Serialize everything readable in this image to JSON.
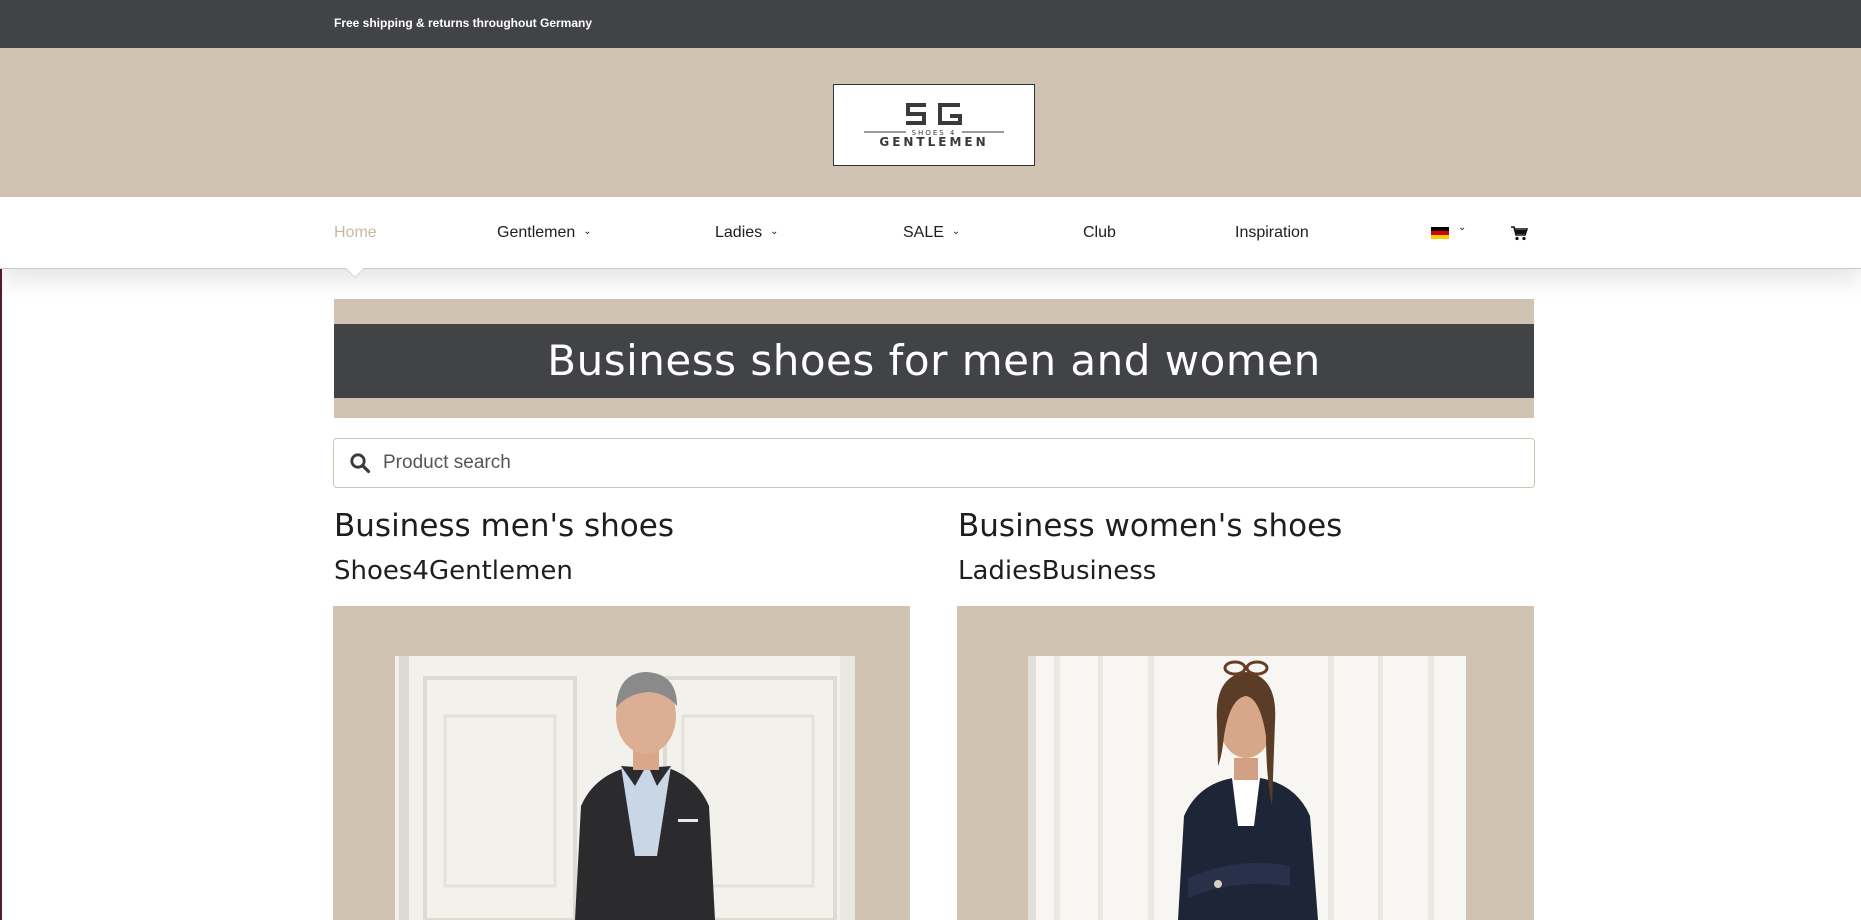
{
  "topbar": {
    "text": "Free shipping & returns throughout Germany"
  },
  "logo": {
    "line1": "SHOES 4",
    "line2": "GENTLEMEN"
  },
  "nav": {
    "items": [
      {
        "label": "Home",
        "active": true,
        "dropdown": false
      },
      {
        "label": "Gentlemen",
        "active": false,
        "dropdown": true
      },
      {
        "label": "Ladies",
        "active": false,
        "dropdown": true
      },
      {
        "label": "SALE",
        "active": false,
        "dropdown": true
      },
      {
        "label": "Club",
        "active": false,
        "dropdown": false
      },
      {
        "label": "Inspiration",
        "active": false,
        "dropdown": false
      }
    ],
    "language_icon": "german-flag-icon",
    "cart_icon": "shopping-cart-icon"
  },
  "hero": {
    "title": "Business shoes for men and women"
  },
  "search": {
    "placeholder": "Product search",
    "value": ""
  },
  "columns": [
    {
      "title": "Business men's shoes",
      "subtitle": "Shoes4Gentlemen"
    },
    {
      "title": "Business women's shoes",
      "subtitle": "LadiesBusiness"
    }
  ],
  "colors": {
    "topbar": "#424346",
    "beige": "#d1c3b1",
    "active_nav": "#c9b8a4",
    "text": "#1e1e1e"
  }
}
